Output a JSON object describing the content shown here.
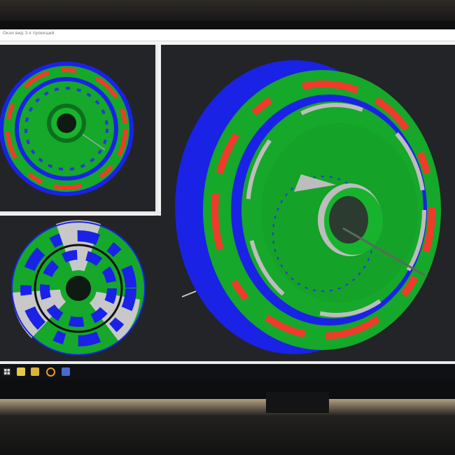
{
  "window": {
    "title": "Окно вид 3-х проекций"
  },
  "taskbar": {
    "icons": [
      "windows-start-icon",
      "file-explorer-icon",
      "sticky-notes-icon",
      "chrome-icon",
      "app-icon"
    ]
  },
  "colors": {
    "background": "#232427",
    "surface_green": "#15a82a",
    "deviation_blue": "#1a22e6",
    "deviation_red": "#f03a2a",
    "neutral_gray": "#bdbdbd",
    "hub_dark": "#0f1a12"
  }
}
